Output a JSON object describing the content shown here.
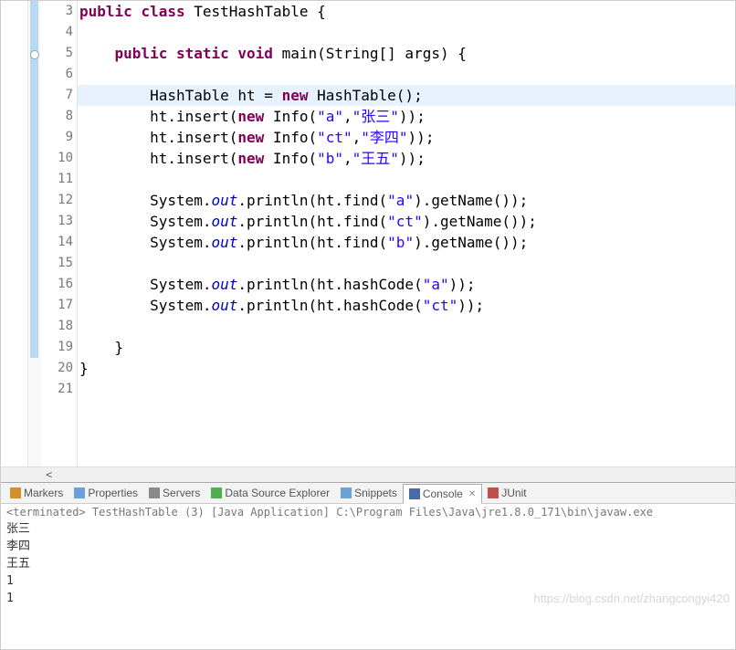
{
  "code": {
    "lines": [
      {
        "n": "3",
        "fold": true,
        "segs": [
          {
            "t": "public",
            "c": "kw"
          },
          {
            "t": " ",
            "c": "norm"
          },
          {
            "t": "class",
            "c": "kw"
          },
          {
            "t": " TestHashTable {",
            "c": "norm"
          }
        ],
        "indent": ""
      },
      {
        "n": "4",
        "fold": true,
        "segs": [
          {
            "t": "",
            "c": "norm"
          }
        ],
        "indent": ""
      },
      {
        "n": "5",
        "fold": true,
        "circle": true,
        "segs": [
          {
            "t": "    ",
            "c": "norm"
          },
          {
            "t": "public",
            "c": "kw"
          },
          {
            "t": " ",
            "c": "norm"
          },
          {
            "t": "static",
            "c": "kw"
          },
          {
            "t": " ",
            "c": "norm"
          },
          {
            "t": "void",
            "c": "kw"
          },
          {
            "t": " main(String[] args) {",
            "c": "norm"
          }
        ],
        "indent": ""
      },
      {
        "n": "6",
        "fold": true,
        "segs": [
          {
            "t": "",
            "c": "norm"
          }
        ],
        "indent": ""
      },
      {
        "n": "7",
        "fold": true,
        "hl": true,
        "segs": [
          {
            "t": "        HashTable ht = ",
            "c": "norm"
          },
          {
            "t": "new",
            "c": "kw"
          },
          {
            "t": " HashTable();",
            "c": "norm"
          }
        ],
        "indent": ""
      },
      {
        "n": "8",
        "fold": true,
        "segs": [
          {
            "t": "        ht.insert(",
            "c": "norm"
          },
          {
            "t": "new",
            "c": "kw"
          },
          {
            "t": " Info(",
            "c": "norm"
          },
          {
            "t": "\"a\"",
            "c": "str"
          },
          {
            "t": ",",
            "c": "norm"
          },
          {
            "t": "\"张三\"",
            "c": "str"
          },
          {
            "t": "));",
            "c": "norm"
          }
        ],
        "indent": ""
      },
      {
        "n": "9",
        "fold": true,
        "segs": [
          {
            "t": "        ht.insert(",
            "c": "norm"
          },
          {
            "t": "new",
            "c": "kw"
          },
          {
            "t": " Info(",
            "c": "norm"
          },
          {
            "t": "\"ct\"",
            "c": "str"
          },
          {
            "t": ",",
            "c": "norm"
          },
          {
            "t": "\"李四\"",
            "c": "str"
          },
          {
            "t": "));",
            "c": "norm"
          }
        ],
        "indent": ""
      },
      {
        "n": "10",
        "fold": true,
        "segs": [
          {
            "t": "        ht.insert(",
            "c": "norm"
          },
          {
            "t": "new",
            "c": "kw"
          },
          {
            "t": " Info(",
            "c": "norm"
          },
          {
            "t": "\"b\"",
            "c": "str"
          },
          {
            "t": ",",
            "c": "norm"
          },
          {
            "t": "\"王五\"",
            "c": "str"
          },
          {
            "t": "));",
            "c": "norm"
          }
        ],
        "indent": ""
      },
      {
        "n": "11",
        "fold": true,
        "segs": [
          {
            "t": "",
            "c": "norm"
          }
        ],
        "indent": ""
      },
      {
        "n": "12",
        "fold": true,
        "segs": [
          {
            "t": "        System.",
            "c": "norm"
          },
          {
            "t": "out",
            "c": "fld"
          },
          {
            "t": ".println(ht.find(",
            "c": "norm"
          },
          {
            "t": "\"a\"",
            "c": "str"
          },
          {
            "t": ").getName());",
            "c": "norm"
          }
        ],
        "indent": ""
      },
      {
        "n": "13",
        "fold": true,
        "segs": [
          {
            "t": "        System.",
            "c": "norm"
          },
          {
            "t": "out",
            "c": "fld"
          },
          {
            "t": ".println(ht.find(",
            "c": "norm"
          },
          {
            "t": "\"ct\"",
            "c": "str"
          },
          {
            "t": ").getName());",
            "c": "norm"
          }
        ],
        "indent": ""
      },
      {
        "n": "14",
        "fold": true,
        "segs": [
          {
            "t": "        System.",
            "c": "norm"
          },
          {
            "t": "out",
            "c": "fld"
          },
          {
            "t": ".println(ht.find(",
            "c": "norm"
          },
          {
            "t": "\"b\"",
            "c": "str"
          },
          {
            "t": ").getName());",
            "c": "norm"
          }
        ],
        "indent": ""
      },
      {
        "n": "15",
        "fold": true,
        "segs": [
          {
            "t": "",
            "c": "norm"
          }
        ],
        "indent": ""
      },
      {
        "n": "16",
        "fold": true,
        "segs": [
          {
            "t": "        System.",
            "c": "norm"
          },
          {
            "t": "out",
            "c": "fld"
          },
          {
            "t": ".println(ht.hashCode(",
            "c": "norm"
          },
          {
            "t": "\"a\"",
            "c": "str"
          },
          {
            "t": "));",
            "c": "norm"
          }
        ],
        "indent": ""
      },
      {
        "n": "17",
        "fold": true,
        "segs": [
          {
            "t": "        System.",
            "c": "norm"
          },
          {
            "t": "out",
            "c": "fld"
          },
          {
            "t": ".println(ht.hashCode(",
            "c": "norm"
          },
          {
            "t": "\"ct\"",
            "c": "str"
          },
          {
            "t": "));",
            "c": "norm"
          }
        ],
        "indent": ""
      },
      {
        "n": "18",
        "fold": true,
        "segs": [
          {
            "t": "",
            "c": "norm"
          }
        ],
        "indent": ""
      },
      {
        "n": "19",
        "fold": true,
        "segs": [
          {
            "t": "    }",
            "c": "norm"
          }
        ],
        "indent": ""
      },
      {
        "n": "20",
        "fold": false,
        "segs": [
          {
            "t": "}",
            "c": "norm"
          }
        ],
        "indent": ""
      },
      {
        "n": "21",
        "fold": false,
        "segs": [
          {
            "t": "",
            "c": "norm"
          }
        ],
        "indent": ""
      }
    ]
  },
  "tabs": [
    {
      "label": "Markers",
      "icon": "#d48f2a"
    },
    {
      "label": "Properties",
      "icon": "#6aa1d8"
    },
    {
      "label": "Servers",
      "icon": "#8a8a8a"
    },
    {
      "label": "Data Source Explorer",
      "icon": "#4fae4f"
    },
    {
      "label": "Snippets",
      "icon": "#6aa1d8"
    },
    {
      "label": "Console",
      "icon": "#4a6aa5",
      "active": true,
      "close": true
    },
    {
      "label": "JUnit",
      "icon": "#c0504d"
    }
  ],
  "console": {
    "header": "<terminated> TestHashTable (3) [Java Application] C:\\Program Files\\Java\\jre1.8.0_171\\bin\\javaw.exe",
    "lines": [
      "张三",
      "李四",
      "王五",
      "1",
      "1"
    ]
  },
  "watermark": "https://blog.csdn.net/zhangcongyi420"
}
